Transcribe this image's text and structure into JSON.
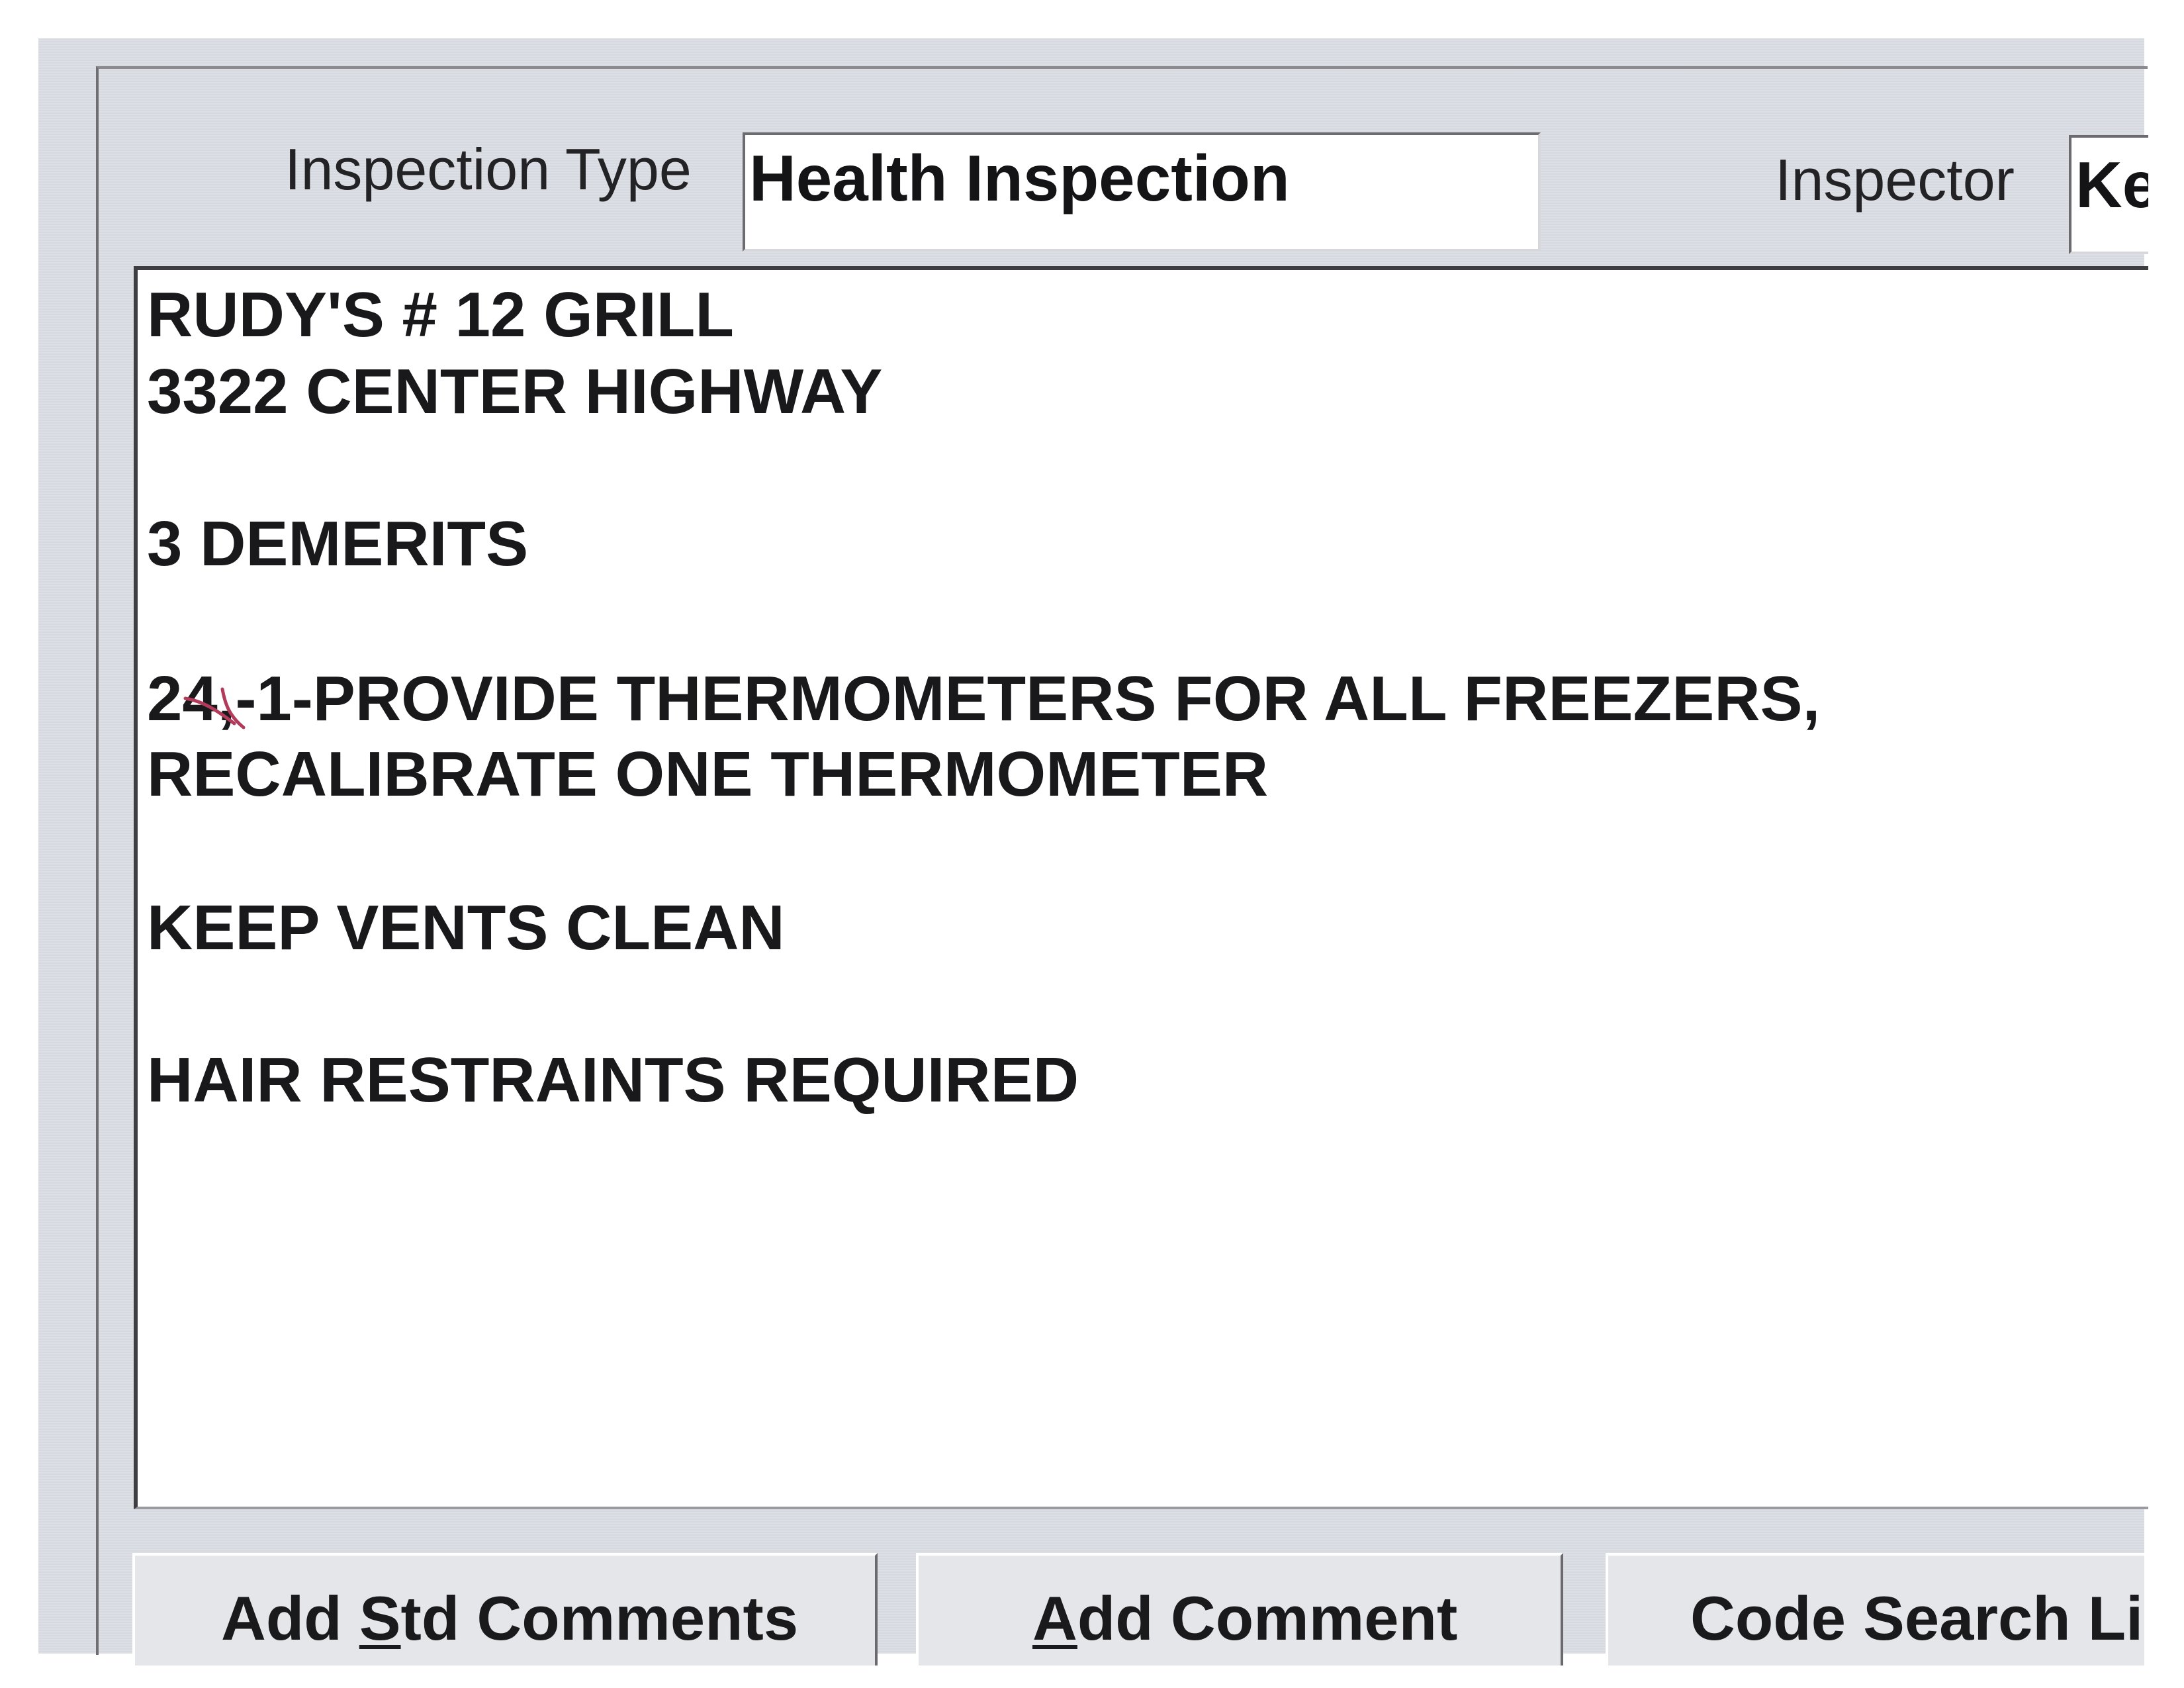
{
  "form": {
    "inspection_type_label": "Inspection Type",
    "inspection_type_value": "Health Inspection",
    "inspector_label": "Inspector",
    "inspector_value": "Ke"
  },
  "comments": {
    "lines": [
      "RUDY'S # 12 GRILL",
      "3322 CENTER HIGHWAY",
      "3 DEMERITS",
      "24,-1-PROVIDE THERMOMETERS FOR ALL FREEZERS,",
      "RECALIBRATE ONE THERMOMETER",
      "KEEP VENTS CLEAN",
      "HAIR RESTRAINTS REQUIRED"
    ]
  },
  "buttons": {
    "add_std_comments": {
      "before": "Add ",
      "mnemonic": "S",
      "after": "td Comments"
    },
    "add_comment": {
      "before": "",
      "mnemonic": "A",
      "after": "dd Comment"
    },
    "code_search": {
      "label": "Code Search Li"
    }
  },
  "colors": {
    "window_bg": "#dadde3",
    "field_bg": "#ffffff",
    "text": "#19191c",
    "handwritten_mark": "#b23a5a"
  }
}
